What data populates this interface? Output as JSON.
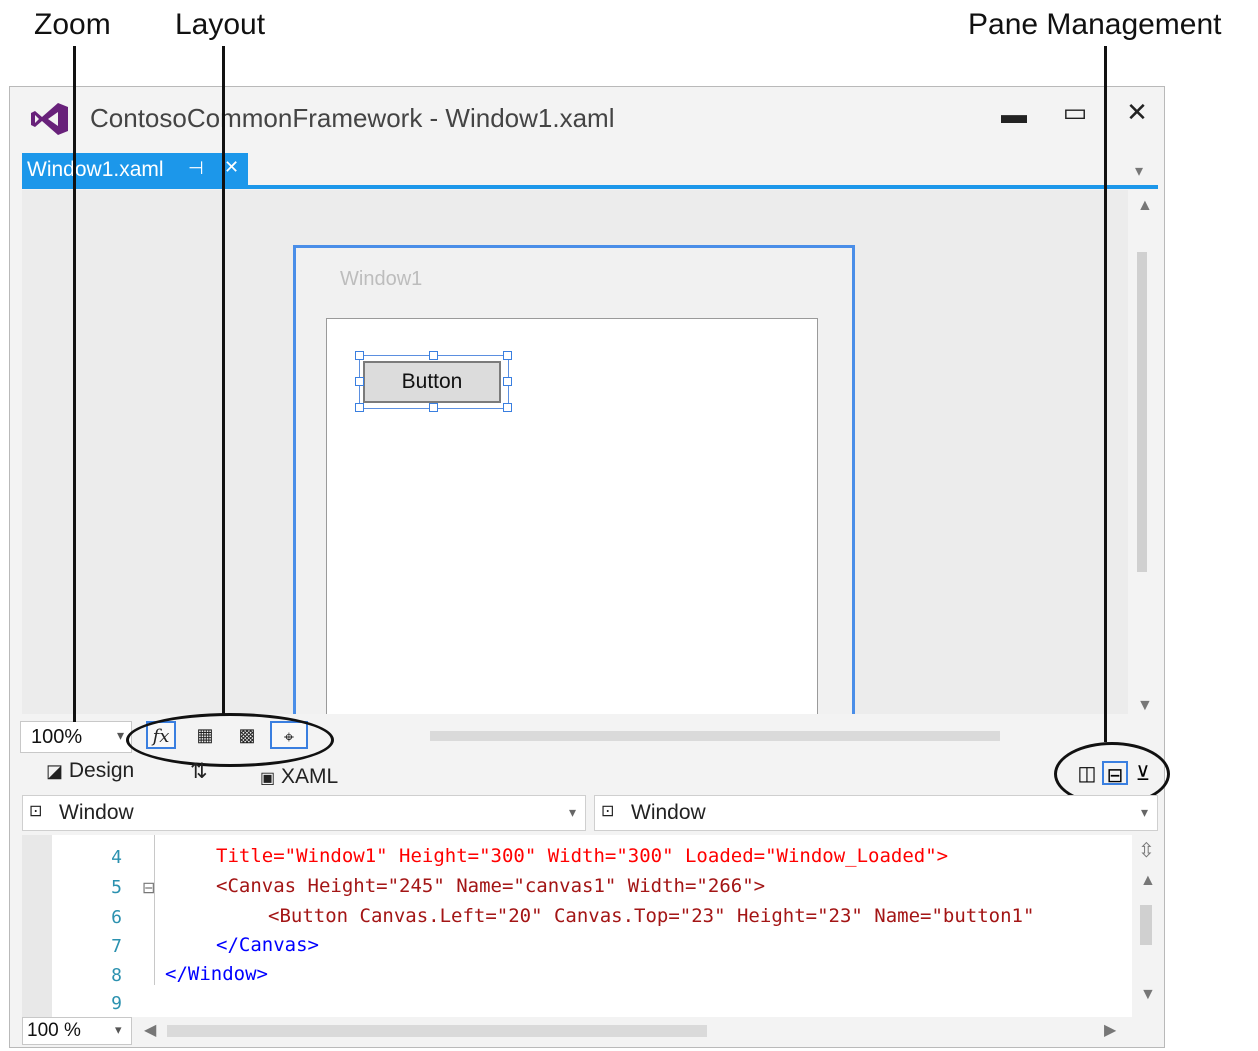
{
  "callouts": {
    "zoom": "Zoom",
    "layout": "Layout",
    "pane_management": "Pane Management"
  },
  "window": {
    "title": "ContosoCommonFramework - Window1.xaml",
    "minimize_glyph": "▬",
    "maximize_glyph": "▭",
    "close_glyph": "✕"
  },
  "doc_tab": {
    "label": "Window1.xaml",
    "pin_glyph": "⊣",
    "close_glyph": "✕",
    "overflow_glyph": "▾"
  },
  "designer": {
    "form_title": "Window1",
    "button_label": "Button"
  },
  "toolbar": {
    "zoom_value": "100%",
    "zoom_dropdown_glyph": "▾",
    "effects_glyph": "fx",
    "grid_glyph": "▦",
    "snap_grid_glyph": "▩",
    "snap_lines_glyph": "⌖"
  },
  "pane_tabs": {
    "design_label": "Design",
    "swap_glyph": "⇅",
    "xaml_label": "XAML"
  },
  "pane_mgmt": {
    "vertical_split_glyph": "◫",
    "horizontal_split_glyph": "⊟",
    "collapse_glyph": "⊻"
  },
  "combos": {
    "left_label": "Window",
    "right_label": "Window",
    "dropdown_glyph": "▾"
  },
  "code": {
    "line_numbers": [
      "4",
      "5",
      "6",
      "7",
      "8",
      "9"
    ],
    "collapse_glyph": "⊟",
    "lines": [
      "Title=\"Window1\" Height=\"300\" Width=\"300\" Loaded=\"Window_Loaded\">",
      "<Canvas Height=\"245\" Name=\"canvas1\" Width=\"266\">",
      "<Button Canvas.Left=\"20\" Canvas.Top=\"23\" Height=\"23\" Name=\"button1\"",
      "</Canvas>",
      "</Window>"
    ]
  },
  "code_zoom": {
    "value": "100 %",
    "dropdown_glyph": "▾"
  },
  "colors": {
    "accent": "#1c97ea",
    "vs_logo": "#68217a",
    "selection": "#3a7fe0"
  }
}
